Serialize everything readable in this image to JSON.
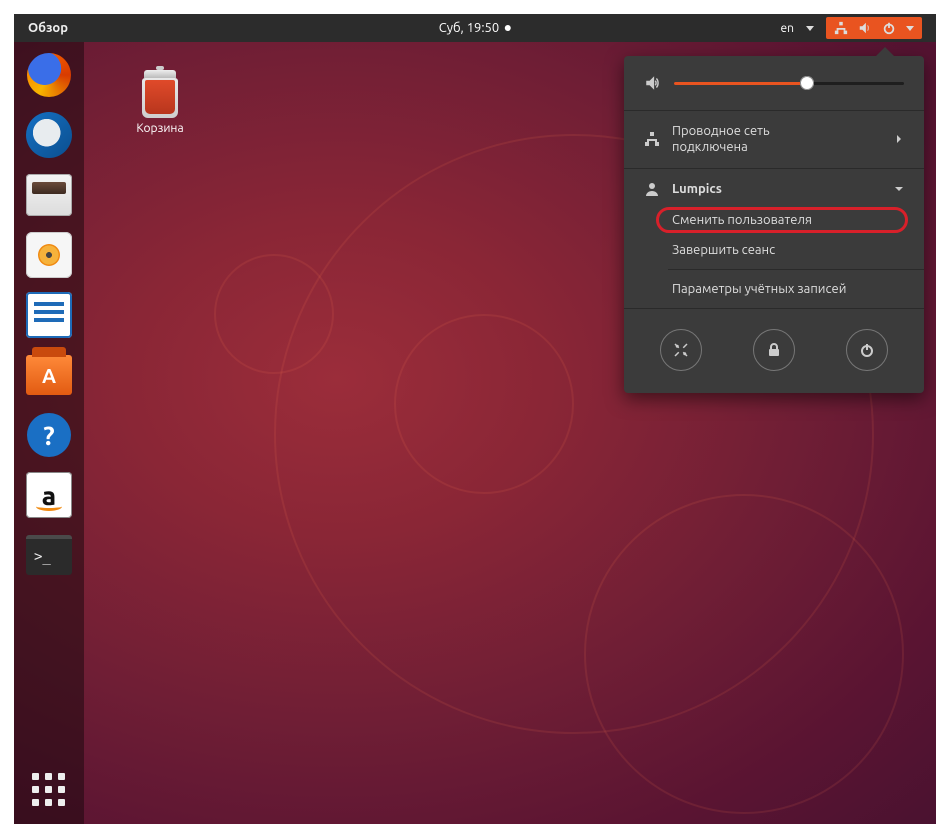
{
  "topbar": {
    "activities_label": "Обзор",
    "clock_text": "Суб, 19:50",
    "language_indicator": "en"
  },
  "desktop": {
    "trash_label": "Корзина"
  },
  "dock": {
    "apps": [
      {
        "name": "firefox"
      },
      {
        "name": "thunderbird"
      },
      {
        "name": "files"
      },
      {
        "name": "rhythmbox"
      },
      {
        "name": "libreoffice-writer"
      },
      {
        "name": "ubuntu-software"
      },
      {
        "name": "help"
      },
      {
        "name": "amazon"
      },
      {
        "name": "terminal"
      }
    ]
  },
  "system_menu": {
    "volume_percent": 58,
    "network": {
      "title": "Проводное сеть",
      "status": "подключена"
    },
    "user": {
      "name": "Lumpics",
      "switch_user_label": "Сменить пользователя",
      "logout_label": "Завершить сеанс",
      "account_settings_label": "Параметры учётных записей"
    },
    "actions": {
      "settings": "settings",
      "lock": "lock",
      "power": "power"
    }
  }
}
